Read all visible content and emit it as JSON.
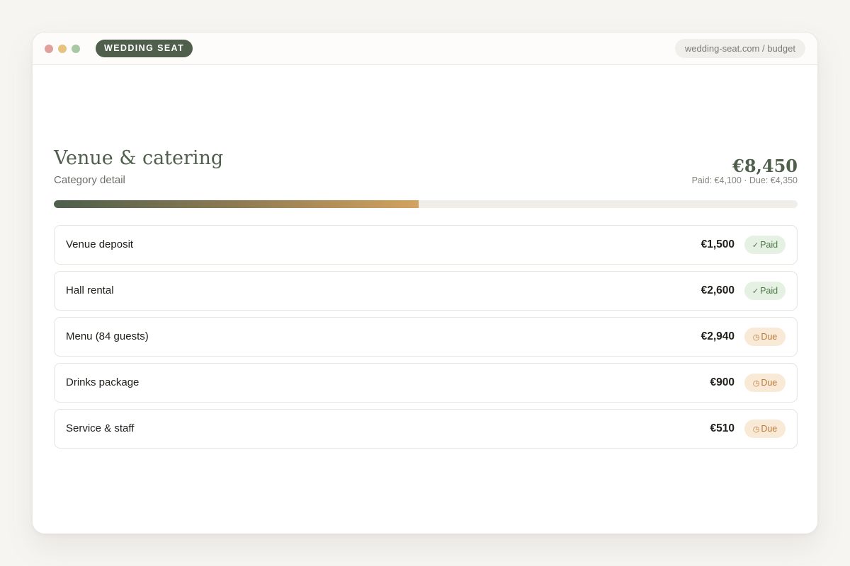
{
  "window": {
    "brand": "WEDDING SEAT",
    "url": "wedding-seat.com / budget"
  },
  "category": {
    "title": "Venue & catering",
    "subtitle": "Category detail",
    "total": "€8,450",
    "paid_summary": "Paid: €4,100 · Due: €4,350",
    "paid_fraction": 0.49
  },
  "items": [
    {
      "name": "Venue deposit",
      "amount": "€1,500",
      "status": "Paid",
      "status_icon": "check-icon"
    },
    {
      "name": "Hall rental",
      "amount": "€2,600",
      "status": "Paid",
      "status_icon": "check-icon"
    },
    {
      "name": "Menu (84 guests)",
      "amount": "€2,940",
      "status": "Due",
      "status_icon": "clock-icon"
    },
    {
      "name": "Drinks package",
      "amount": "€900",
      "status": "Due",
      "status_icon": "clock-icon"
    },
    {
      "name": "Service & staff",
      "amount": "€510",
      "status": "Due",
      "status_icon": "clock-icon"
    }
  ],
  "colors": {
    "brand": "#4f5f4c",
    "paid_badge": "#e5f1e2",
    "due_badge": "#f9ead8",
    "progress_end": "#d3a35e"
  }
}
